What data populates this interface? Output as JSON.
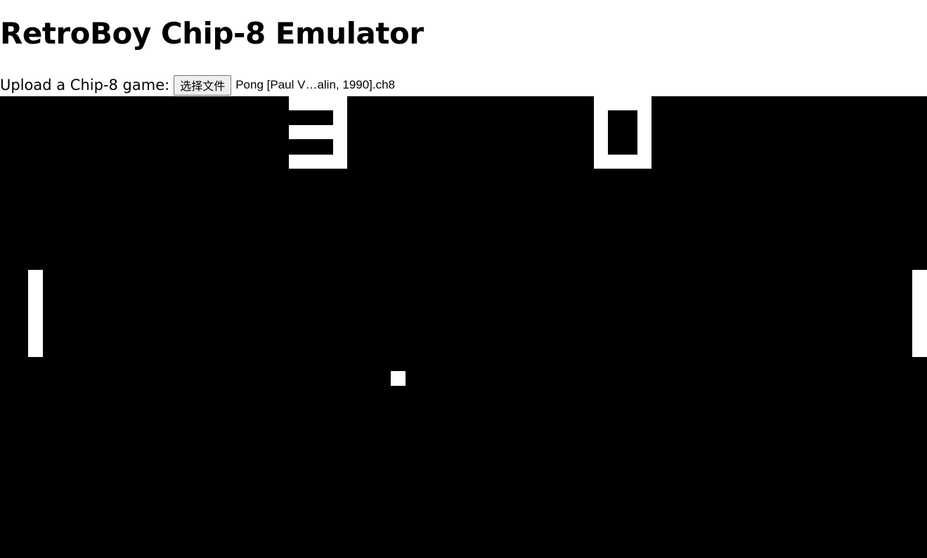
{
  "page": {
    "title": "RetroBoy Chip-8 Emulator"
  },
  "upload": {
    "label": "Upload a Chip-8 game:",
    "button_label": "选择文件",
    "file_name": "Pong [Paul V…alin, 1990].ch8"
  },
  "game": {
    "name": "Pong",
    "score_left": "3",
    "score_right": "0",
    "foreground_color": "#ffffff",
    "background_color": "#000000"
  }
}
